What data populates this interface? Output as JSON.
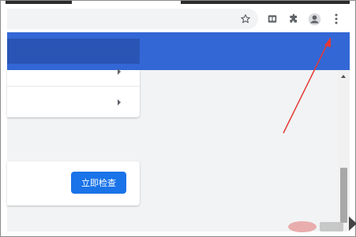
{
  "toolbar": {
    "icons": [
      "star-icon",
      "reading-list-icon",
      "extensions-icon",
      "profile-icon",
      "more-menu-icon"
    ]
  },
  "settings": {
    "safety_check_button": "立即检查"
  },
  "colors": {
    "header_blue": "#3367d6",
    "button_blue": "#1a73e8",
    "annotation_red": "#e53935"
  }
}
